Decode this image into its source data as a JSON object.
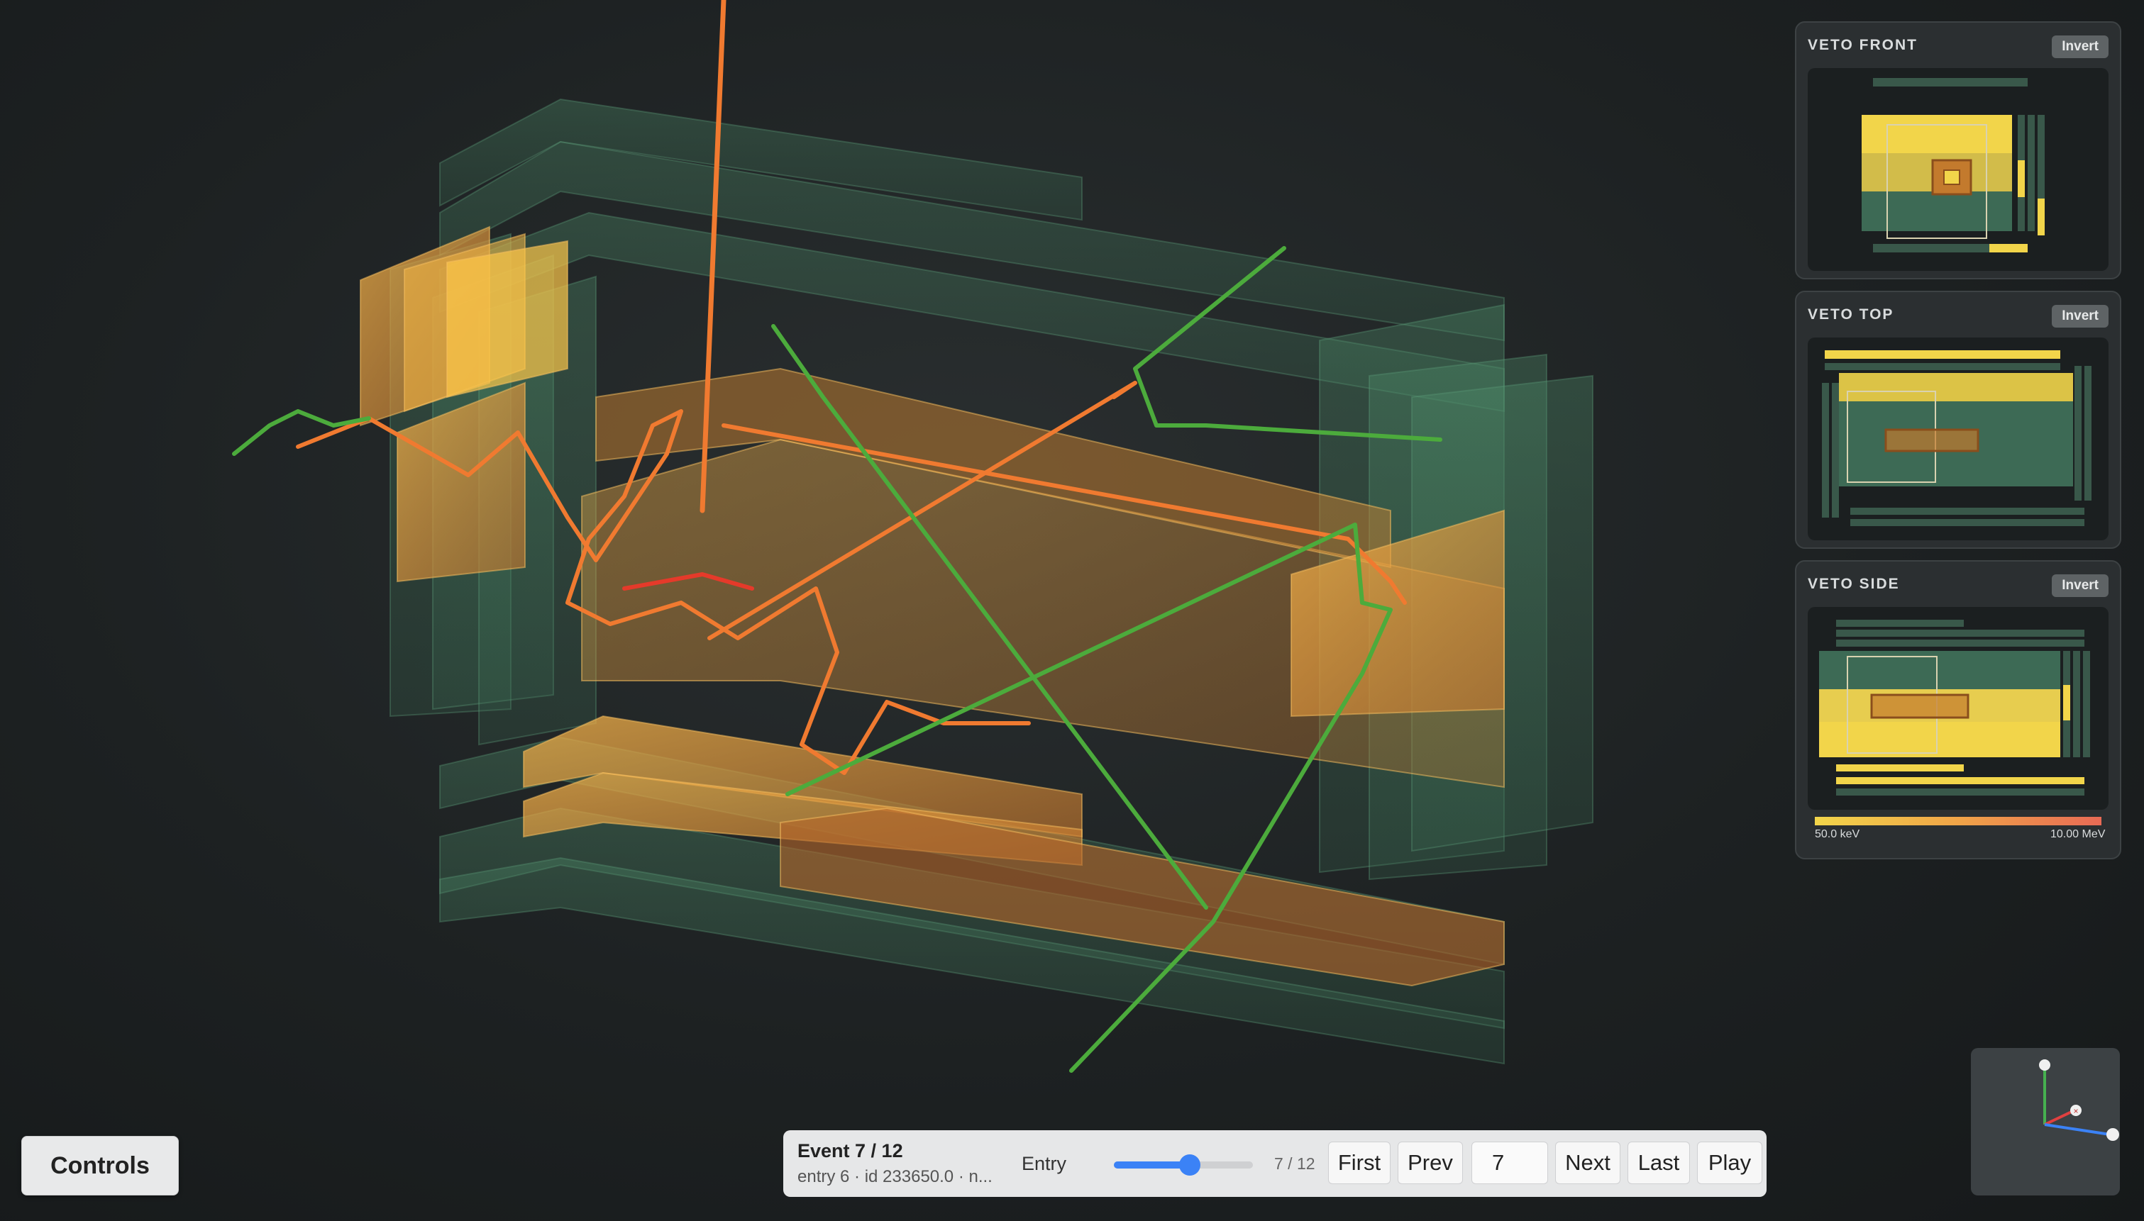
{
  "veto_panels": [
    {
      "title": "VETO FRONT",
      "invert_label": "Invert"
    },
    {
      "title": "VETO TOP",
      "invert_label": "Invert"
    },
    {
      "title": "VETO SIDE",
      "invert_label": "Invert"
    }
  ],
  "energy_scale": {
    "min_label": "50.0 keV",
    "max_label": "10.00 MeV"
  },
  "controls_button": "Controls",
  "event_bar": {
    "title": "Event 7 / 12",
    "subtitle": "entry 6 · id 233650.0 · n...",
    "entry_label": "Entry",
    "slider_value": 7,
    "slider_max": 12,
    "count_label": "7 / 12",
    "first_label": "First",
    "prev_label": "Prev",
    "page_value": "7",
    "next_label": "Next",
    "last_label": "Last",
    "play_label": "Play"
  },
  "axes": {
    "icons": [
      "y-axis-icon",
      "x-axis-icon",
      "z-axis-icon"
    ]
  },
  "colors": {
    "veto_green": "#4f8f6b",
    "hit_yellow": "#f2d54a",
    "track_orange": "#f07a30",
    "track_green": "#4cab3c",
    "accent_blue": "#3b82f6"
  }
}
